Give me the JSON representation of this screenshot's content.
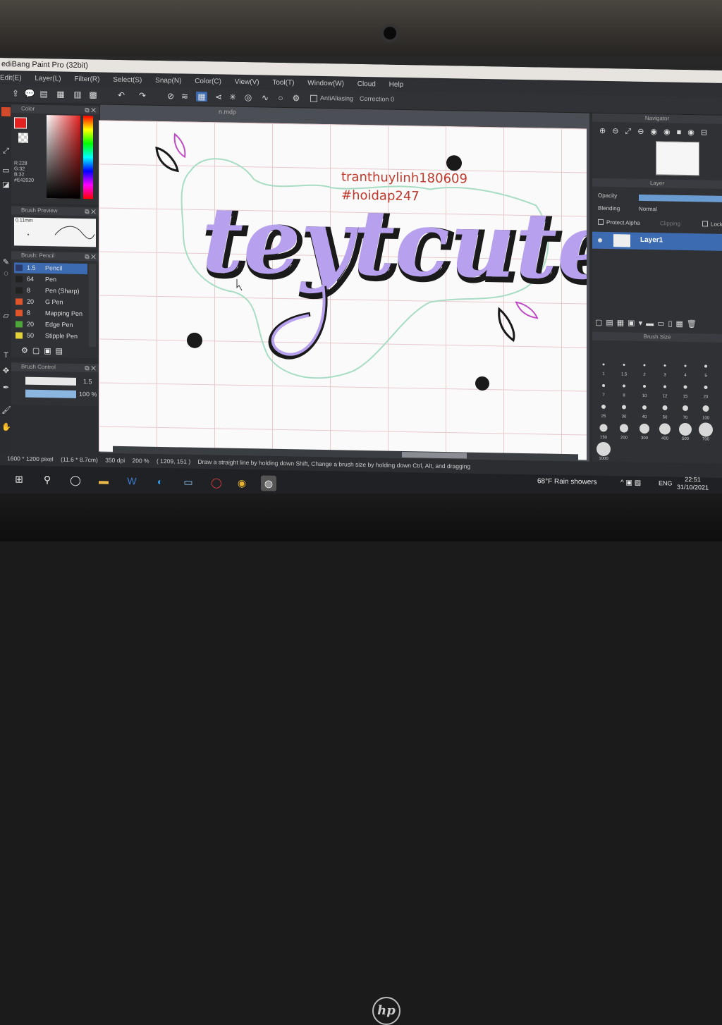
{
  "window": {
    "title": "ediBang Paint Pro (32bit)"
  },
  "menu": [
    "Edit(E)",
    "Layer(L)",
    "Filter(R)",
    "Select(S)",
    "Snap(N)",
    "Color(C)",
    "View(V)",
    "Tool(T)",
    "Window(W)",
    "Cloud",
    "Help"
  ],
  "toolbar": {
    "antialiasing": "AntiAliasing",
    "correction": "Correction",
    "correction_value": "0"
  },
  "color_panel": {
    "title": "Color",
    "rgb_lines": [
      "R:228",
      "G:32",
      "B:32",
      "#E42020"
    ],
    "current": "#e42020"
  },
  "brush_preview": {
    "title": "Brush Preview",
    "size": "0.11mm"
  },
  "brush_list": {
    "title": "Brush: Pencil",
    "items": [
      {
        "size": "1.5",
        "name": "Pencil",
        "color": "#2a3a6a"
      },
      {
        "size": "64",
        "name": "Pen",
        "color": "#222222"
      },
      {
        "size": "8",
        "name": "Pen (Sharp)",
        "color": "#222222"
      },
      {
        "size": "20",
        "name": "G Pen",
        "color": "#e0552b"
      },
      {
        "size": "8",
        "name": "Mapping Pen",
        "color": "#e0552b"
      },
      {
        "size": "20",
        "name": "Edge Pen",
        "color": "#4ca63a"
      },
      {
        "size": "50",
        "name": "Stipple Pen",
        "color": "#e4d23a"
      }
    ]
  },
  "brush_control": {
    "title": "Brush Control",
    "size": "1.5",
    "opacity": "100 %"
  },
  "canvas": {
    "tab": "n.mdp",
    "handle": "tranthuylinh180609",
    "hashtag": "#hoidap247",
    "artwork_text": "teytcute",
    "colors": {
      "lettering": "#b7a1ee",
      "outline": "#1a1a1a",
      "glow": "#a8ddc4",
      "accent": "#c04ac6"
    }
  },
  "status": {
    "size": "1600 * 1200 pixel",
    "physical": "(11.6 * 8.7cm)",
    "dpi": "350 dpi",
    "zoom": "200 %",
    "cursor": "( 1209, 151 )",
    "hint": "Draw a straight line by holding down Shift, Change a brush size by holding down Ctrl, Alt, and dragging"
  },
  "navigator": {
    "title": "Navigator"
  },
  "layer_panel": {
    "title": "Layer",
    "opacity_label": "Opacity",
    "blending_label": "Blending",
    "blending_value": "Normal",
    "protect_alpha": "Protect Alpha",
    "clipping": "Clipping",
    "lock": "Lock",
    "layers": [
      "Layer1"
    ]
  },
  "brush_size": {
    "title": "Brush Size",
    "sizes": [
      "1",
      "1.5",
      "2",
      "3",
      "4",
      "5",
      "7",
      "8",
      "10",
      "12",
      "15",
      "20",
      "25",
      "30",
      "40",
      "50",
      "70",
      "100",
      "150",
      "200",
      "300",
      "400",
      "500",
      "700",
      "1000"
    ]
  },
  "taskbar": {
    "weather": "68°F  Rain showers",
    "lang": "ENG",
    "time": "22:51",
    "date": "31/10/2021"
  }
}
